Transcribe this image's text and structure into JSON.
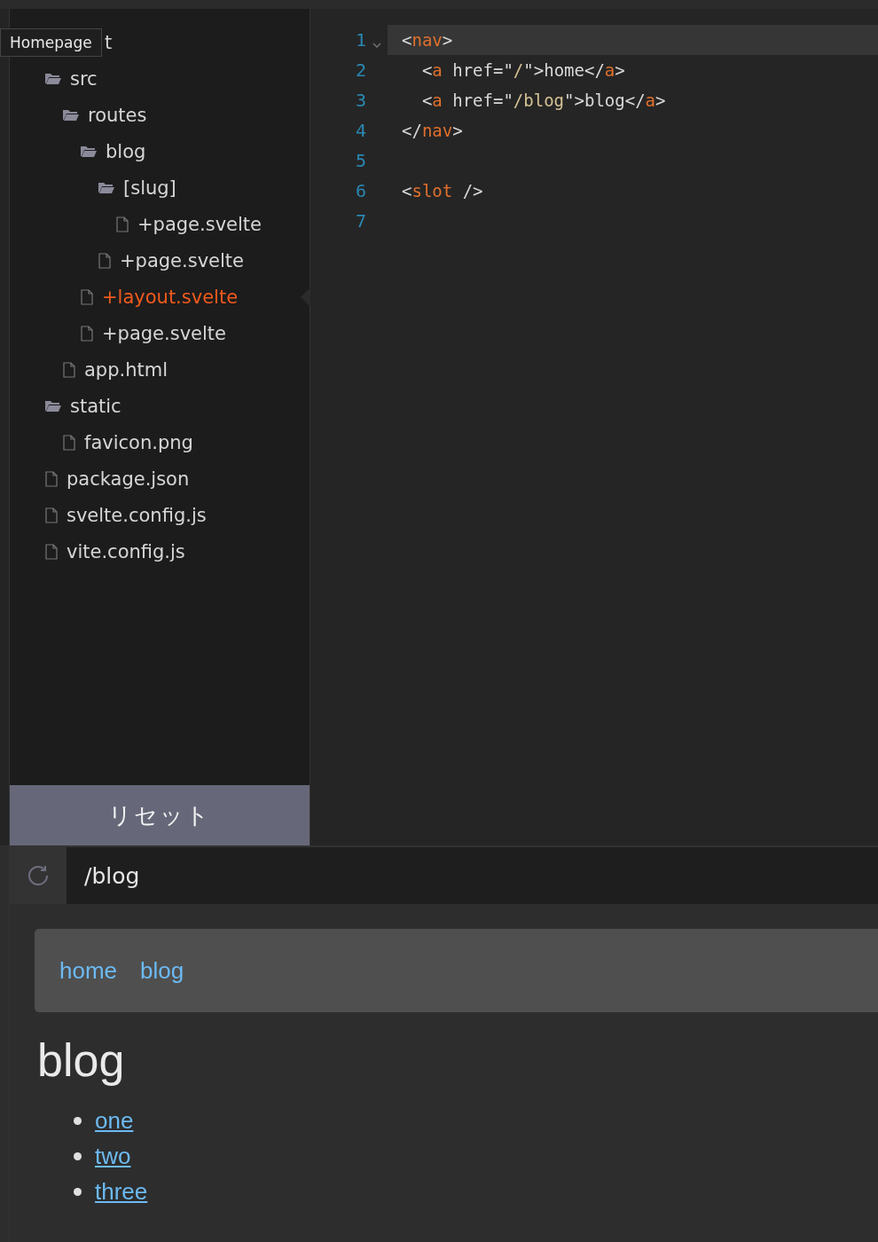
{
  "tooltip": {
    "text": "Homepage"
  },
  "file_tree": {
    "items": [
      {
        "name": "t",
        "selected": false,
        "children": [
          {
            "name": "src",
            "kind": "folder",
            "selected": false,
            "children": [
              {
                "name": "routes",
                "kind": "folder",
                "selected": false,
                "children": [
                  {
                    "name": "blog",
                    "kind": "folder",
                    "selected": false,
                    "children": [
                      {
                        "name": "[slug]",
                        "kind": "folder",
                        "selected": false,
                        "children": [
                          {
                            "name": "+page.svelte",
                            "kind": "file",
                            "selected": false
                          }
                        ]
                      },
                      {
                        "name": "+page.svelte",
                        "kind": "file",
                        "selected": false
                      }
                    ]
                  },
                  {
                    "name": "+layout.svelte",
                    "kind": "file",
                    "selected": true
                  },
                  {
                    "name": "+page.svelte",
                    "kind": "file",
                    "selected": false
                  }
                ]
              },
              {
                "name": "app.html",
                "kind": "file",
                "selected": false
              }
            ]
          },
          {
            "name": "static",
            "kind": "folder",
            "selected": false,
            "children": [
              {
                "name": "favicon.png",
                "kind": "file",
                "selected": false
              }
            ]
          },
          {
            "name": "package.json",
            "kind": "file",
            "selected": false
          },
          {
            "name": "svelte.config.js",
            "kind": "file",
            "selected": false
          },
          {
            "name": "vite.config.js",
            "kind": "file",
            "selected": false
          }
        ]
      }
    ]
  },
  "reset_button": {
    "label": "リセット"
  },
  "editor": {
    "lines": [
      {
        "number": "1",
        "foldable": true,
        "highlighted": true,
        "tokens": [
          {
            "kind": "punct",
            "text": "<"
          },
          {
            "kind": "tag",
            "text": "nav"
          },
          {
            "kind": "punct",
            "text": ">"
          }
        ]
      },
      {
        "number": "2",
        "foldable": false,
        "highlighted": false,
        "tokens": [
          {
            "kind": "punct",
            "text": "  <"
          },
          {
            "kind": "tag",
            "text": "a"
          },
          {
            "kind": "punct",
            "text": " href=\""
          },
          {
            "kind": "string",
            "text": "/"
          },
          {
            "kind": "punct",
            "text": "\">home</"
          },
          {
            "kind": "tag",
            "text": "a"
          },
          {
            "kind": "punct",
            "text": ">"
          }
        ]
      },
      {
        "number": "3",
        "foldable": false,
        "highlighted": false,
        "tokens": [
          {
            "kind": "punct",
            "text": "  <"
          },
          {
            "kind": "tag",
            "text": "a"
          },
          {
            "kind": "punct",
            "text": " href=\""
          },
          {
            "kind": "string",
            "text": "/blog"
          },
          {
            "kind": "punct",
            "text": "\">blog</"
          },
          {
            "kind": "tag",
            "text": "a"
          },
          {
            "kind": "punct",
            "text": ">"
          }
        ]
      },
      {
        "number": "4",
        "foldable": false,
        "highlighted": false,
        "tokens": [
          {
            "kind": "punct",
            "text": "</"
          },
          {
            "kind": "tag",
            "text": "nav"
          },
          {
            "kind": "punct",
            "text": ">"
          }
        ]
      },
      {
        "number": "5",
        "foldable": false,
        "highlighted": false
      },
      {
        "number": "6",
        "foldable": false,
        "highlighted": false,
        "tokens": [
          {
            "kind": "punct",
            "text": "<"
          },
          {
            "kind": "tag",
            "text": "slot"
          },
          {
            "kind": "punct",
            "text": " />"
          }
        ]
      },
      {
        "number": "7",
        "foldable": false,
        "highlighted": false
      }
    ]
  },
  "address_bar": {
    "url": "/blog"
  },
  "preview": {
    "nav_links": [
      "home",
      "blog"
    ],
    "heading": "blog",
    "list_links": [
      "one",
      "two",
      "three"
    ]
  }
}
